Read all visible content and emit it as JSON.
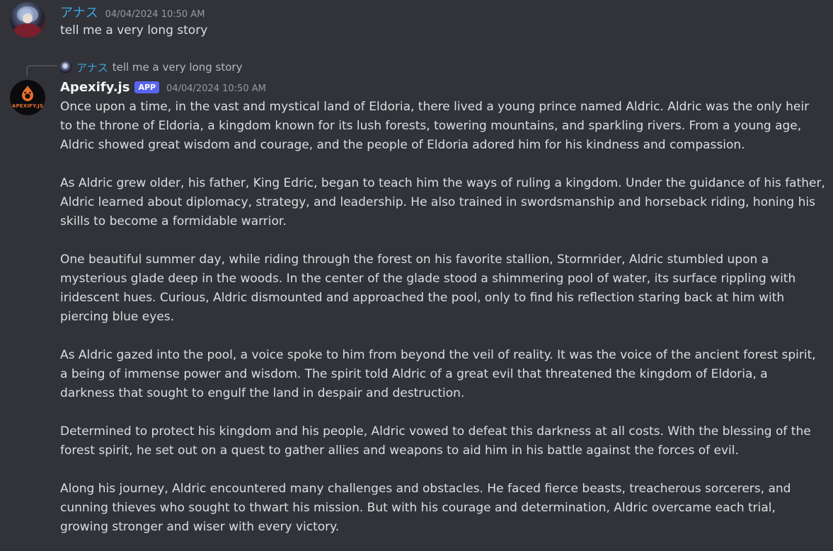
{
  "message1": {
    "username": "アナス",
    "timestamp": "04/04/2024 10:50 AM",
    "text": "tell me a very long story"
  },
  "reply": {
    "username": "アナス",
    "text": "tell me a very long story"
  },
  "message2": {
    "username": "Apexify.js",
    "badge": "APP",
    "timestamp": "04/04/2024 10:50 AM",
    "avatar_label": "APEXIFY.JS",
    "paragraphs": [
      {
        "lines": [
          "Once upon a time, in the vast and mystical land of Eldoria, there lived a young prince named Aldric. Aldric was the only heir",
          "to the throne of Eldoria, a kingdom known for its lush forests, towering mountains, and sparkling rivers. From a young age,",
          "Aldric showed great wisdom and courage, and the people of Eldoria adored him for his kindness and compassion."
        ]
      },
      {
        "lines": [
          "As Aldric grew older, his father, King Edric, began to teach him the ways of ruling a kingdom. Under the guidance of his father,",
          "Aldric learned about diplomacy, strategy, and leadership. He also trained in swordsmanship and horseback riding, honing his",
          "skills to become a formidable warrior."
        ]
      },
      {
        "lines": [
          "One beautiful summer day, while riding through the forest on his favorite stallion, Stormrider, Aldric stumbled upon a",
          "mysterious glade deep in the woods. In the center of the glade stood a shimmering pool of water, its surface rippling with",
          "iridescent hues. Curious, Aldric dismounted and approached the pool, only to find his reflection staring back at him with",
          "piercing blue eyes."
        ]
      },
      {
        "lines": [
          "As Aldric gazed into the pool, a voice spoke to him from beyond the veil of reality. It was the voice of the ancient forest spirit,",
          "a being of immense power and wisdom. The spirit told Aldric of a great evil that threatened the kingdom of Eldoria, a",
          "darkness that sought to engulf the land in despair and destruction."
        ]
      },
      {
        "lines": [
          "Determined to protect his kingdom and his people, Aldric vowed to defeat this darkness at all costs. With the blessing of the",
          "forest spirit, he set out on a quest to gather allies and weapons to aid him in his battle against the forces of evil."
        ]
      },
      {
        "lines": [
          "Along his journey, Aldric encountered many challenges and obstacles. He faced fierce beasts, treacherous sorcerers, and",
          "cunning thieves who sought to thwart his mission. But with his courage and determination, Aldric overcame each trial,",
          "growing stronger and wiser with every victory."
        ]
      }
    ]
  },
  "colors": {
    "background": "#313338",
    "user_name": "#3ba3e0",
    "bot_name": "#f2f3f5",
    "badge": "#5865f2",
    "text": "#dbdee1",
    "timestamp": "#949ba4"
  }
}
